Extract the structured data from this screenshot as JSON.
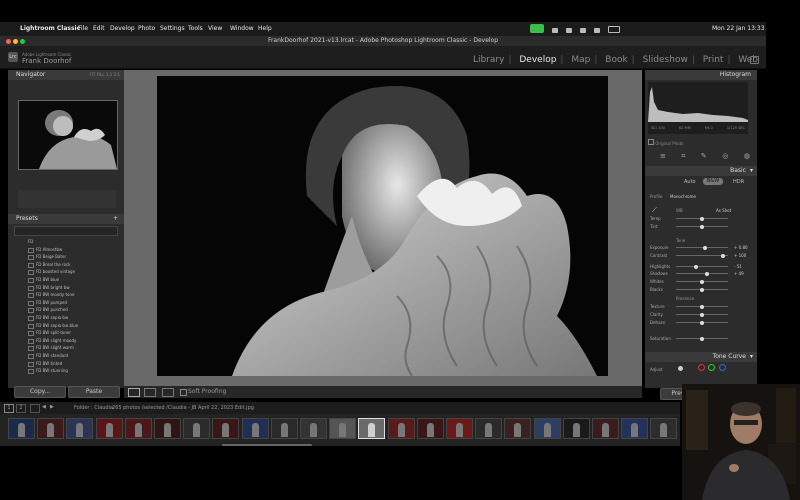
{
  "menubar": {
    "app_name": "Lightroom Classic",
    "items": [
      "File",
      "Edit",
      "Develop",
      "Photo",
      "Settings",
      "Tools",
      "View",
      "Window",
      "Help"
    ],
    "datetime": "Mon 22 Jan 13:33"
  },
  "window": {
    "title": "FrankDoorhof 2021-v13.lrcat - Adobe Photoshop Lightroom Classic - Develop"
  },
  "identity": {
    "logo": "Lrc",
    "subtitle": "Adobe Lightroom Classic",
    "name": "Frank Doorhof"
  },
  "modules": [
    "Library",
    "Develop",
    "Map",
    "Book",
    "Slideshow",
    "Print",
    "Web"
  ],
  "active_module": "Develop",
  "left_panel": {
    "navigator_title": "Navigator",
    "navigator_zoom": "FIT  FILL  1:1  3:1",
    "presets_title": "Presets",
    "presets_group": "FD",
    "presets": [
      "FD Almostbw",
      "FD Beige Bater",
      "FD Breal the rock",
      "FD boosted vintage",
      "FD BW blue",
      "FD BW bright bw",
      "FD BW moody tone",
      "FD BW pumped",
      "FD BW punched",
      "FD BW sepia bw",
      "FD BW sepia bw blue",
      "FD BW split-toner",
      "FD BW slight moody",
      "FD BW slight warm",
      "FD BW standard",
      "FD BW tinted",
      "FD BW stunning"
    ],
    "copy_label": "Copy...",
    "paste_label": "Paste"
  },
  "toolbar": {
    "soft_proofing": "Soft Proofing"
  },
  "right_panel": {
    "histogram_title": "Histogram",
    "histogram_labels": [
      "ISO 100",
      "62 MM",
      "f/9.0",
      "1/125 SEC"
    ],
    "original_photo": "Original Photo",
    "basic_title": "Basic",
    "treatment_options": [
      "Auto",
      "B&W",
      "HDR"
    ],
    "profile_label": "Profile",
    "profile_value": "Monochrome",
    "wb_label": "WB",
    "wb_value": "As Shot",
    "tone_label": "Tone",
    "presence_label": "Presence",
    "sliders": [
      {
        "name": "Temp",
        "value": ""
      },
      {
        "name": "Tint",
        "value": ""
      },
      {
        "name": "Exposure",
        "value": "+ 0.80"
      },
      {
        "name": "Contrast",
        "value": "+ 100"
      },
      {
        "name": "Highlights",
        "value": "- 51"
      },
      {
        "name": "Shadows",
        "value": "+ 49"
      },
      {
        "name": "Whites",
        "value": ""
      },
      {
        "name": "Blacks",
        "value": ""
      },
      {
        "name": "Texture",
        "value": ""
      },
      {
        "name": "Clarity",
        "value": ""
      },
      {
        "name": "Dehaze",
        "value": ""
      },
      {
        "name": "Saturation",
        "value": ""
      }
    ],
    "tone_curve_title": "Tone Curve",
    "adjust_label": "Adjust",
    "previous_label": "Previous"
  },
  "filmstrip": {
    "pages": [
      "1",
      "2"
    ],
    "folder_info": "Folder : Claudia",
    "count_info": "265 photos /selected /Claudia - JB April 22, 2023 Edit.jpg"
  },
  "colors": {
    "accent": "#e6e6e6",
    "panel": "#2c2c2c",
    "center_bg": "#696969"
  }
}
